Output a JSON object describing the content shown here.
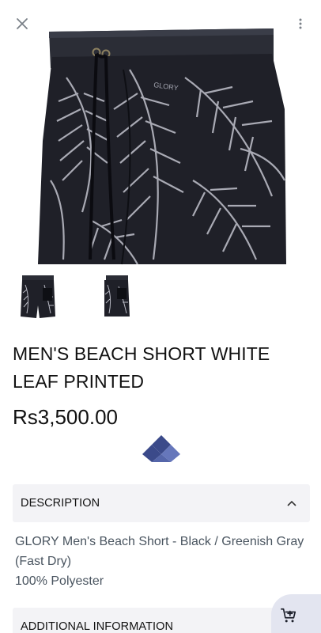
{
  "toolbar": {
    "close_icon": "close-icon",
    "more_icon": "more-vertical-icon"
  },
  "product": {
    "title": "MEN'S BEACH SHORT WHITE LEAF PRINTED",
    "price": "Rs3,500.00",
    "hero_image": "beach-short-leaf-print-photo",
    "thumbnails": [
      "front-view",
      "back-view"
    ]
  },
  "brand": {
    "mark_icon": "brand-diamond-icon",
    "primary_color": "#3b4a8a",
    "secondary_color": "#6677bb"
  },
  "sections": {
    "description": {
      "label": "DESCRIPTION",
      "expanded": true,
      "lines": [
        "GLORY Men's Beach Short - Black / Greenish Gray (Fast Dry)",
        "100% Polyester"
      ]
    },
    "additional": {
      "label": "ADDITIONAL INFORMATION",
      "expanded": false
    }
  },
  "cart": {
    "icon": "add-to-cart-icon",
    "background": "#e3e5f0"
  }
}
